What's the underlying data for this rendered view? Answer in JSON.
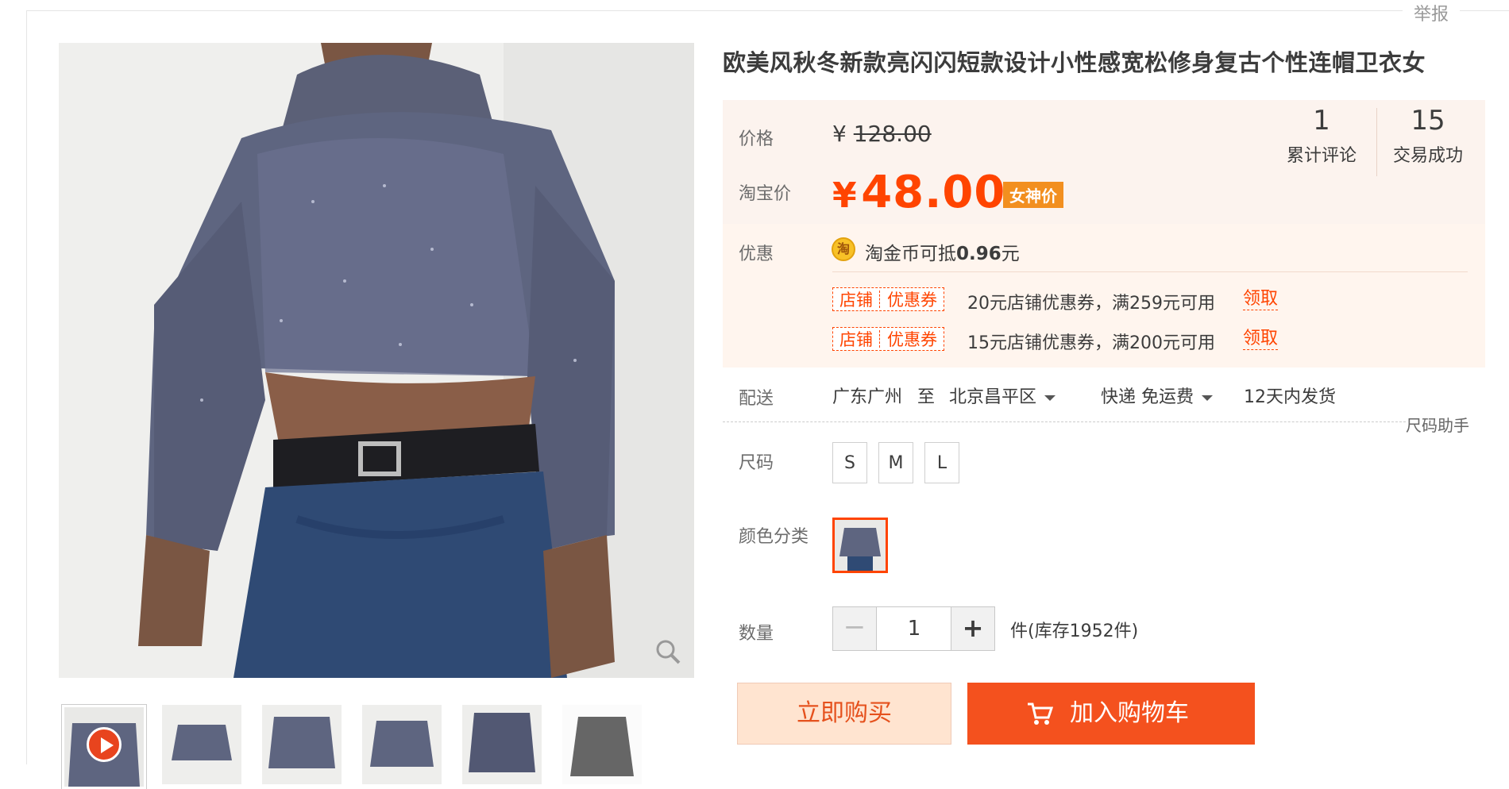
{
  "report_link": "举报",
  "product": {
    "title": "欧美风秋冬新款亮闪闪短款设计小性感宽松修身复古个性连帽卫衣女"
  },
  "price": {
    "label": "价格",
    "currency": "¥",
    "original": "128.00",
    "taobao_label": "淘宝价",
    "sale_currency": "¥",
    "sale": "48.00",
    "badge": "女神价"
  },
  "stats": [
    {
      "value": "1",
      "label": "累计评论"
    },
    {
      "value": "15",
      "label": "交易成功"
    }
  ],
  "promo": {
    "label": "优惠",
    "coin_icon_text": "淘",
    "coin_text": "淘金币可抵",
    "coin_amount": "0.96",
    "coin_unit": "元",
    "coupons": [
      {
        "tag_left": "店铺",
        "tag_right": "优惠券",
        "text": "20元店铺优惠券，满259元可用",
        "claim": "领取"
      },
      {
        "tag_left": "店铺",
        "tag_right": "优惠券",
        "text": "15元店铺优惠券，满200元可用",
        "claim": "领取"
      }
    ]
  },
  "shipping": {
    "label": "配送",
    "from": "广东广州",
    "to_word": "至",
    "to": "北京昌平区",
    "method": "快递 免运费",
    "dispatch": "12天内发货"
  },
  "size_helper": "尺码助手",
  "size": {
    "label": "尺码",
    "options": [
      "S",
      "M",
      "L"
    ]
  },
  "color": {
    "label": "颜色分类"
  },
  "quantity": {
    "label": "数量",
    "minus": "−",
    "value": "1",
    "plus": "+",
    "stock": "件(库存1952件)"
  },
  "actions": {
    "buy_now": "立即购买",
    "add_cart": "加入购物车"
  },
  "colors": {
    "accent": "#ff4400",
    "price_bg": "#fcf3ee",
    "buy_now_bg": "#ffe4d0",
    "add_cart_bg": "#f4511e"
  }
}
